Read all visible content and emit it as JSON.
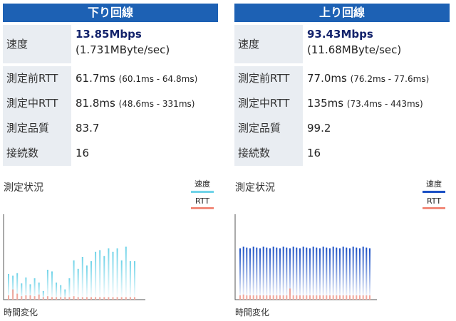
{
  "panels": [
    {
      "title": "下り回線",
      "speed_label": "速度",
      "speed_main": "13.85Mbps",
      "speed_sub": "(1.731MByte/sec)",
      "rows": [
        {
          "label": "測定前RTT",
          "value": "61.7ms",
          "detail": "(60.1ms - 64.8ms)"
        },
        {
          "label": "測定中RTT",
          "value": "81.8ms",
          "detail": "(48.6ms - 331ms)"
        },
        {
          "label": "測定品質",
          "value": "83.7",
          "detail": ""
        },
        {
          "label": "接続数",
          "value": "16",
          "detail": ""
        }
      ],
      "chart_title": "測定状況",
      "legend_speed": "速度",
      "legend_rtt": "RTT",
      "xlabel": "時間変化",
      "colors": {
        "speed": "#6fd3e8",
        "rtt": "#f28b7b"
      },
      "chart_data": {
        "type": "bar",
        "series": [
          {
            "name": "速度",
            "values": [
              0.3,
              0.28,
              0.31,
              0.19,
              0.26,
              0.18,
              0.25,
              0.2,
              0.1,
              0.35,
              0.33,
              0.2,
              0.17,
              0.12,
              0.25,
              0.46,
              0.36,
              0.5,
              0.4,
              0.45,
              0.56,
              0.58,
              0.51,
              0.6,
              0.56,
              0.6,
              0.46,
              0.62,
              0.45,
              0.45
            ]
          },
          {
            "name": "RTT",
            "values": [
              0.05,
              0.12,
              0.07,
              0.04,
              0.05,
              0.05,
              0.04,
              0.06,
              0.03,
              0.04,
              0.03,
              0.03,
              0.03,
              0.03,
              0.03,
              0.04,
              0.03,
              0.03,
              0.03,
              0.03,
              0.03,
              0.03,
              0.03,
              0.03,
              0.03,
              0.03,
              0.03,
              0.03,
              0.03,
              0.03
            ]
          }
        ]
      }
    },
    {
      "title": "上り回線",
      "speed_label": "速度",
      "speed_main": "93.43Mbps",
      "speed_sub": "(11.68MByte/sec)",
      "rows": [
        {
          "label": "測定前RTT",
          "value": "77.0ms",
          "detail": "(76.2ms - 77.6ms)"
        },
        {
          "label": "測定中RTT",
          "value": "135ms",
          "detail": "(73.4ms - 443ms)"
        },
        {
          "label": "測定品質",
          "value": "99.2",
          "detail": ""
        },
        {
          "label": "接続数",
          "value": "16",
          "detail": ""
        }
      ],
      "chart_title": "測定状況",
      "legend_speed": "速度",
      "legend_rtt": "RTT",
      "xlabel": "時間変化",
      "colors": {
        "speed": "#1a4fc4",
        "rtt": "#f28b7b"
      },
      "chart_data": {
        "type": "bar",
        "series": [
          {
            "name": "速度",
            "values": [
              0.6,
              0.62,
              0.61,
              0.6,
              0.62,
              0.61,
              0.6,
              0.62,
              0.61,
              0.6,
              0.62,
              0.61,
              0.6,
              0.62,
              0.61,
              0.6,
              0.62,
              0.61,
              0.6,
              0.62,
              0.61,
              0.6,
              0.62,
              0.61,
              0.6,
              0.62,
              0.61,
              0.6,
              0.62,
              0.61,
              0.6,
              0.62,
              0.61,
              0.6,
              0.62,
              0.61,
              0.6,
              0.62,
              0.61,
              0.6
            ]
          },
          {
            "name": "RTT",
            "values": [
              0.05,
              0.06,
              0.05,
              0.05,
              0.05,
              0.05,
              0.05,
              0.05,
              0.05,
              0.05,
              0.05,
              0.05,
              0.05,
              0.05,
              0.05,
              0.13,
              0.05,
              0.05,
              0.05,
              0.05,
              0.05,
              0.05,
              0.05,
              0.05,
              0.05,
              0.05,
              0.05,
              0.05,
              0.05,
              0.05,
              0.05,
              0.05,
              0.05,
              0.05,
              0.05,
              0.05,
              0.05,
              0.05,
              0.05,
              0.05
            ]
          }
        ]
      }
    }
  ]
}
